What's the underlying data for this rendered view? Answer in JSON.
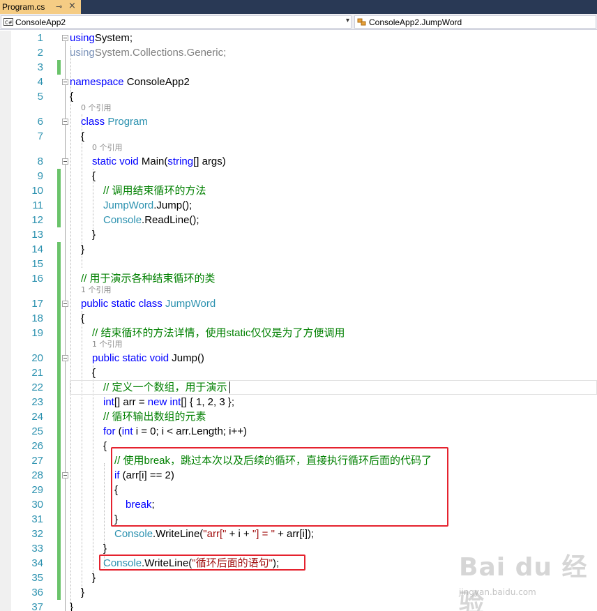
{
  "tab": {
    "title": "Program.cs",
    "pin_icon": "pin-icon",
    "close_icon": "close-icon"
  },
  "navbar": {
    "project_combo": "ConsoleApp2",
    "member_combo": "ConsoleApp2.JumpWord"
  },
  "editor": {
    "lines": [
      {
        "n": "1",
        "tokens": [
          [
            "kw",
            "using"
          ],
          [
            "",
            "System;"
          ]
        ]
      },
      {
        "n": "2",
        "tokens": [
          [
            "grey-kw",
            "using"
          ],
          [
            "grey",
            "System.Collections.Generic;"
          ]
        ]
      },
      {
        "n": "3",
        "tokens": []
      },
      {
        "n": "4",
        "tokens": [
          [
            "kw",
            "namespace"
          ],
          [
            "",
            " ConsoleApp2"
          ]
        ]
      },
      {
        "n": "5",
        "tokens": [
          [
            "",
            "{"
          ]
        ]
      },
      {
        "n": "6",
        "tokens": [
          [
            "kw",
            "class"
          ],
          [
            "",
            " "
          ],
          [
            "ty",
            "Program"
          ]
        ]
      },
      {
        "n": "7",
        "tokens": [
          [
            "",
            "{"
          ]
        ]
      },
      {
        "n": "8",
        "tokens": [
          [
            "kw",
            "static"
          ],
          [
            "",
            " "
          ],
          [
            "kw",
            "void"
          ],
          [
            "",
            " Main("
          ],
          [
            "kw",
            "string"
          ],
          [
            "",
            "[] args)"
          ]
        ]
      },
      {
        "n": "9",
        "tokens": [
          [
            "",
            "{"
          ]
        ]
      },
      {
        "n": "10",
        "tokens": [
          [
            "cm",
            "// 调用结束循环的方法"
          ]
        ]
      },
      {
        "n": "11",
        "tokens": [
          [
            "ty",
            "JumpWord"
          ],
          [
            "",
            ".Jump();"
          ]
        ]
      },
      {
        "n": "12",
        "tokens": [
          [
            "ty",
            "Console"
          ],
          [
            "",
            ".ReadLine();"
          ]
        ]
      },
      {
        "n": "13",
        "tokens": [
          [
            "",
            "}"
          ]
        ]
      },
      {
        "n": "14",
        "tokens": [
          [
            "",
            "}"
          ]
        ]
      },
      {
        "n": "15",
        "tokens": []
      },
      {
        "n": "16",
        "tokens": [
          [
            "cm",
            "// 用于演示各种结束循环的类"
          ]
        ]
      },
      {
        "n": "17",
        "tokens": [
          [
            "kw",
            "public"
          ],
          [
            "",
            " "
          ],
          [
            "kw",
            "static"
          ],
          [
            "",
            " "
          ],
          [
            "kw",
            "class"
          ],
          [
            "",
            " "
          ],
          [
            "ty",
            "JumpWord"
          ]
        ]
      },
      {
        "n": "18",
        "tokens": [
          [
            "",
            "{"
          ]
        ]
      },
      {
        "n": "19",
        "tokens": [
          [
            "cm",
            "// 结束循环的方法详情，使用static仅仅是为了方便调用"
          ]
        ]
      },
      {
        "n": "20",
        "tokens": [
          [
            "kw",
            "public"
          ],
          [
            "",
            " "
          ],
          [
            "kw",
            "static"
          ],
          [
            "",
            " "
          ],
          [
            "kw",
            "void"
          ],
          [
            "",
            " Jump()"
          ]
        ]
      },
      {
        "n": "21",
        "tokens": [
          [
            "",
            "{"
          ]
        ]
      },
      {
        "n": "22",
        "tokens": [
          [
            "cm",
            "// 定义一个数组，用于演示"
          ]
        ]
      },
      {
        "n": "23",
        "tokens": [
          [
            "kw",
            "int"
          ],
          [
            "",
            "[] arr = "
          ],
          [
            "kw",
            "new"
          ],
          [
            "",
            " "
          ],
          [
            "kw",
            "int"
          ],
          [
            "",
            "[] { 1, 2, 3 };"
          ]
        ]
      },
      {
        "n": "24",
        "tokens": [
          [
            "cm",
            "// 循环输出数组的元素"
          ]
        ]
      },
      {
        "n": "25",
        "tokens": [
          [
            "kw",
            "for"
          ],
          [
            "",
            " ("
          ],
          [
            "kw",
            "int"
          ],
          [
            "",
            " i = 0; i < arr.Length; i++)"
          ]
        ]
      },
      {
        "n": "26",
        "tokens": [
          [
            "",
            "{"
          ]
        ]
      },
      {
        "n": "27",
        "tokens": [
          [
            "cm",
            "// 使用break，跳过本次以及后续的循环，直接执行循环后面的代码了"
          ]
        ]
      },
      {
        "n": "28",
        "tokens": [
          [
            "kw",
            "if"
          ],
          [
            "",
            " (arr[i] == 2)"
          ]
        ]
      },
      {
        "n": "29",
        "tokens": [
          [
            "",
            "{"
          ]
        ]
      },
      {
        "n": "30",
        "tokens": [
          [
            "kw",
            "break"
          ],
          [
            "",
            ";"
          ]
        ]
      },
      {
        "n": "31",
        "tokens": [
          [
            "",
            "}"
          ]
        ]
      },
      {
        "n": "32",
        "tokens": [
          [
            "ty",
            "Console"
          ],
          [
            "",
            ".WriteLine("
          ],
          [
            "st",
            "\"arr[\""
          ],
          [
            "",
            " + i + "
          ],
          [
            "st",
            "\"] = \""
          ],
          [
            "",
            " + arr[i]);"
          ]
        ]
      },
      {
        "n": "33",
        "tokens": [
          [
            "",
            "}"
          ]
        ]
      },
      {
        "n": "34",
        "tokens": [
          [
            "ty",
            "Console"
          ],
          [
            "",
            ".WriteLine("
          ],
          [
            "st",
            "\"循环后面的语句\""
          ],
          [
            "",
            ");"
          ]
        ]
      },
      {
        "n": "35",
        "tokens": [
          [
            "",
            "}"
          ]
        ]
      },
      {
        "n": "36",
        "tokens": [
          [
            "",
            "}"
          ]
        ]
      },
      {
        "n": "37",
        "tokens": [
          [
            "",
            "}"
          ]
        ]
      }
    ],
    "references": {
      "program": "0 个引用",
      "main": "0 个引用",
      "jumpword_class": "1 个引用",
      "jump_method": "1 个引用"
    }
  },
  "watermark": {
    "main": "Bai du 经验",
    "sub": "jingyan.baidu.com"
  },
  "colors": {
    "keyword": "#0000ff",
    "type": "#2b91af",
    "comment": "#008000",
    "string": "#a31515",
    "highlight_box": "#e5222e",
    "change_bar": "#6ac36a",
    "active_tab": "#f5cc84",
    "tab_strip": "#293955"
  }
}
